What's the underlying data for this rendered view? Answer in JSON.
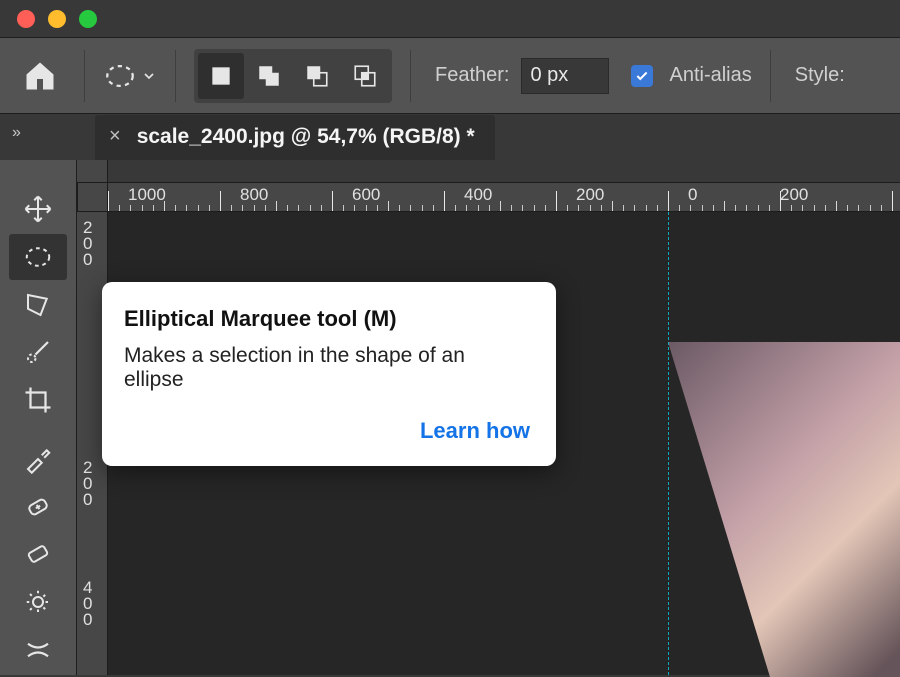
{
  "options": {
    "feather_label": "Feather:",
    "feather_value": "0 px",
    "antialias_checked": true,
    "antialias_label": "Anti-alias",
    "style_label": "Style:"
  },
  "document": {
    "tab_title": "scale_2400.jpg @ 54,7% (RGB/8) *"
  },
  "ruler": {
    "h_labels": [
      "1000",
      "800",
      "600",
      "400",
      "200",
      "0",
      "200"
    ],
    "v_labels_a": [
      "2",
      "0",
      "0"
    ],
    "v_labels_b": [
      "2",
      "0",
      "0"
    ],
    "v_labels_c": [
      "4",
      "0",
      "0"
    ]
  },
  "tooltip": {
    "title": "Elliptical Marquee tool (M)",
    "desc": "Makes a selection in the shape of an ellipse",
    "link": "Learn how"
  },
  "icons": {
    "home": "home",
    "ellipse": "ellipse-marquee",
    "move": "move",
    "lasso": "lasso",
    "brush": "brush",
    "crop": "crop",
    "eyedrop": "eyedropper",
    "heal": "healing-brush",
    "eraser": "eraser",
    "gear": "gear",
    "shuffle": "swap"
  }
}
